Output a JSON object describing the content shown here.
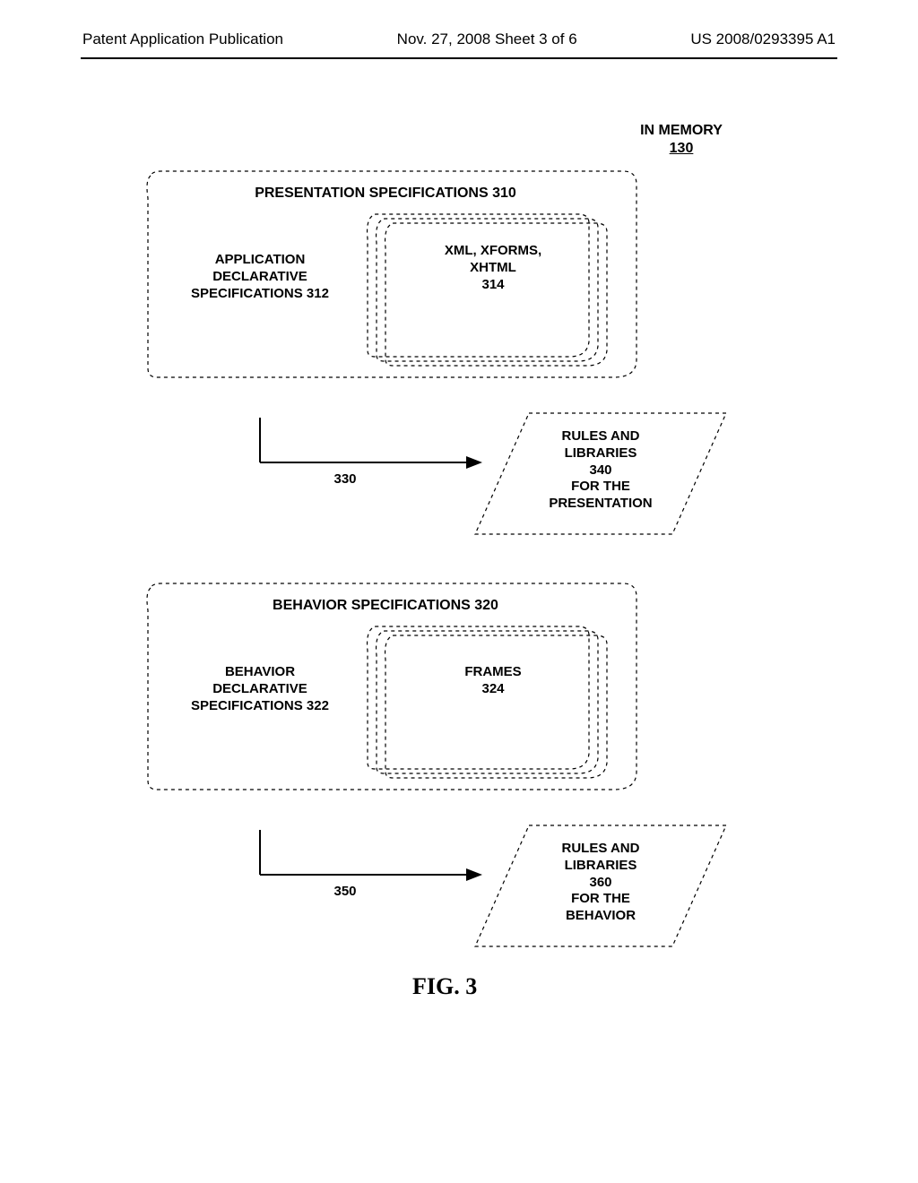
{
  "header": {
    "left": "Patent Application Publication",
    "mid": "Nov. 27, 2008  Sheet 3 of 6",
    "right": "US 2008/0293395 A1"
  },
  "memory": {
    "line1": "IN MEMORY",
    "line2": "130"
  },
  "spec1": {
    "title": "PRESENTATION SPECIFICATIONS 310",
    "leftbox": "APPLICATION\nDECLARATIVE\nSPECIFICATIONS 312",
    "rightbox": "XML, XFORMS,\nXHTML\n314"
  },
  "arrow1": {
    "label": "330"
  },
  "rules1": "RULES AND\nLIBRARIES\n340\nFOR THE\nPRESENTATION",
  "spec2": {
    "title": "BEHAVIOR SPECIFICATIONS 320",
    "leftbox": "BEHAVIOR\nDECLARATIVE\nSPECIFICATIONS 322",
    "rightbox": "FRAMES\n324"
  },
  "arrow2": {
    "label": "350"
  },
  "rules2": "RULES AND\nLIBRARIES\n360\nFOR THE\nBEHAVIOR",
  "figure": "FIG. 3"
}
